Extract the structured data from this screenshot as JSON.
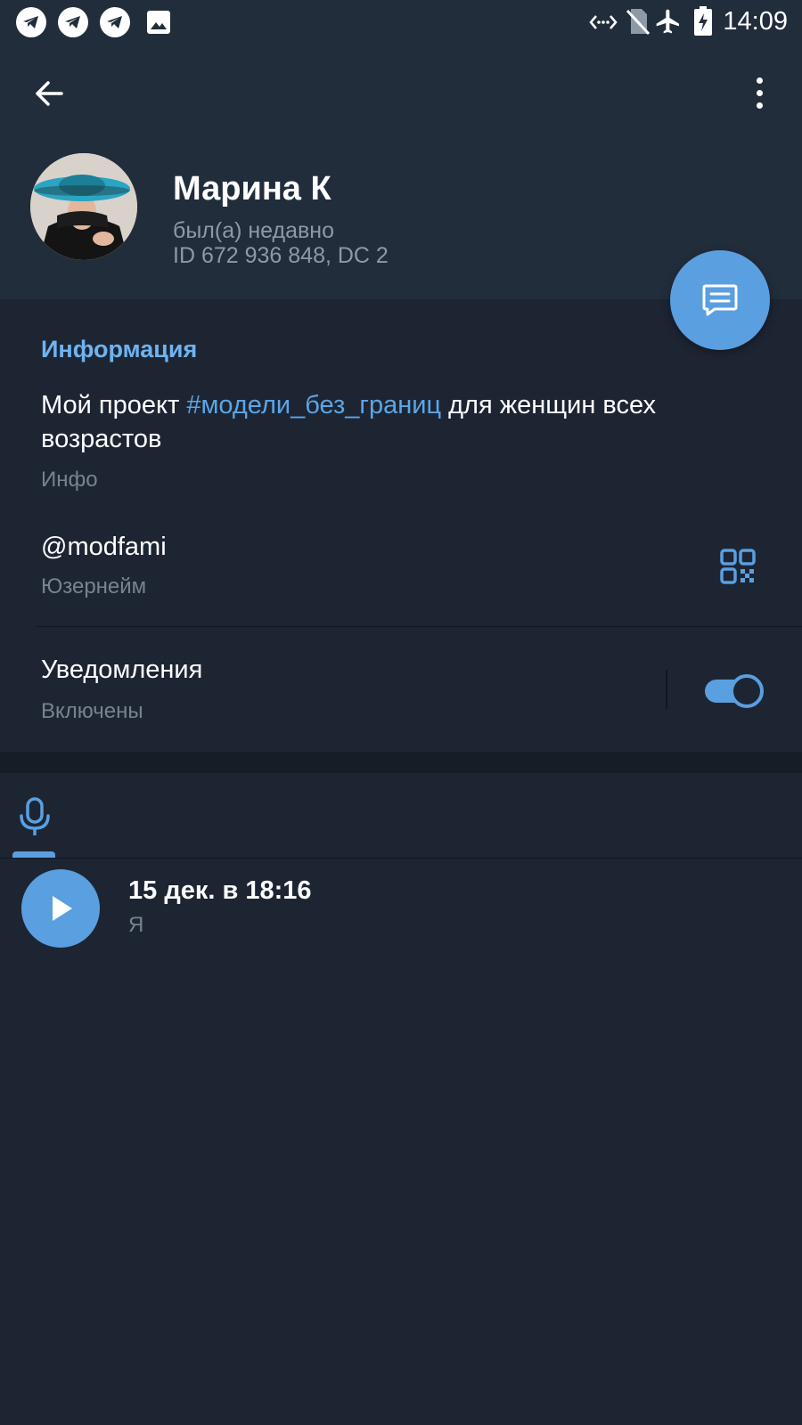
{
  "status_bar": {
    "time": "14:09",
    "left_icons": [
      "telegram-notification-icon",
      "telegram-notification-icon",
      "telegram-notification-icon",
      "image-notification-icon"
    ],
    "right_icons": [
      "data-transfer-icon",
      "no-sim-icon",
      "airplane-mode-icon",
      "battery-charging-icon"
    ]
  },
  "toolbar": {
    "back_icon": "arrow-left-icon",
    "menu_icon": "more-vertical-icon"
  },
  "profile": {
    "name": "Марина К",
    "last_seen": "был(а) недавно",
    "id_line": "ID 672 936 848, DC 2",
    "fab_icon": "message-icon"
  },
  "info": {
    "section_title": "Информация",
    "bio_prefix": "Мой проект ",
    "bio_hashtag": "#модели_без_границ",
    "bio_suffix": " для женщин всех возрастов",
    "bio_caption": "Инфо",
    "username": "@modfami",
    "username_caption": "Юзернейм",
    "qr_icon": "qr-code-icon",
    "notifications_title": "Уведомления",
    "notifications_caption": "Включены",
    "notifications_enabled": true
  },
  "media_tabs": {
    "tabs": [
      {
        "icon": "microphone-icon",
        "active": true
      }
    ]
  },
  "voice_messages": [
    {
      "date": "15 дек. в 18:16",
      "author": "Я",
      "icon": "play-icon"
    }
  ],
  "colors": {
    "background": "#1d2533",
    "header": "#222d3c",
    "accent": "#5a9fe0",
    "link": "#5ba6e6",
    "section_title": "#6fb3f0",
    "secondary_text": "#78838f"
  }
}
